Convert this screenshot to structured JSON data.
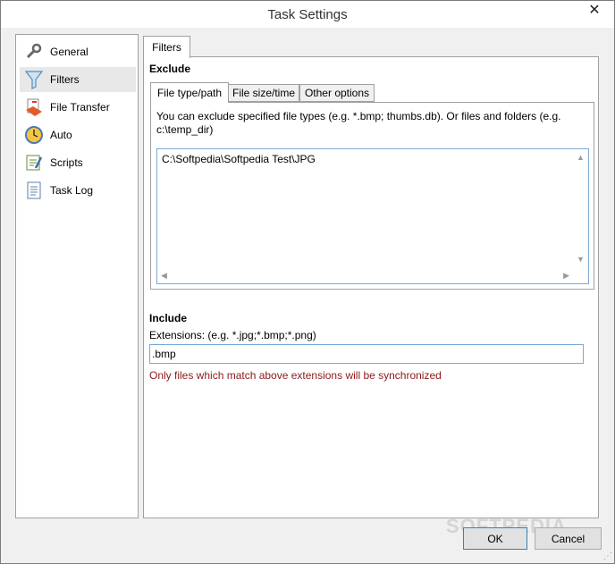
{
  "window": {
    "title": "Task Settings",
    "close_glyph": "✕"
  },
  "sidebar": {
    "items": [
      {
        "label": "General",
        "icon": "wrench-icon"
      },
      {
        "label": "Filters",
        "icon": "funnel-icon"
      },
      {
        "label": "File Transfer",
        "icon": "file-transfer-icon"
      },
      {
        "label": "Auto",
        "icon": "clock-icon"
      },
      {
        "label": "Scripts",
        "icon": "script-icon"
      },
      {
        "label": "Task Log",
        "icon": "log-icon"
      }
    ],
    "selected": "Filters"
  },
  "main": {
    "tab_label": "Filters",
    "exclude": {
      "heading": "Exclude",
      "subtabs": [
        "File type/path",
        "File size/time",
        "Other options"
      ],
      "active_subtab": "File type/path",
      "description": "You can exclude specified file types (e.g. *.bmp; thumbs.db). Or files and folders (e.g. c:\\temp_dir)",
      "entries": [
        "C:\\Softpedia\\Softpedia Test\\JPG"
      ]
    },
    "include": {
      "heading": "Include",
      "extensions_label": "Extensions: (e.g. *.jpg;*.bmp;*.png)",
      "extensions_value": ".bmp",
      "hint": "Only files which match above extensions will be synchronized"
    }
  },
  "footer": {
    "ok_label": "OK",
    "cancel_label": "Cancel"
  },
  "watermark": "SOFTPEDIA",
  "colors": {
    "hint": "#8b1a1a",
    "focus_border": "#7aa9d6"
  }
}
